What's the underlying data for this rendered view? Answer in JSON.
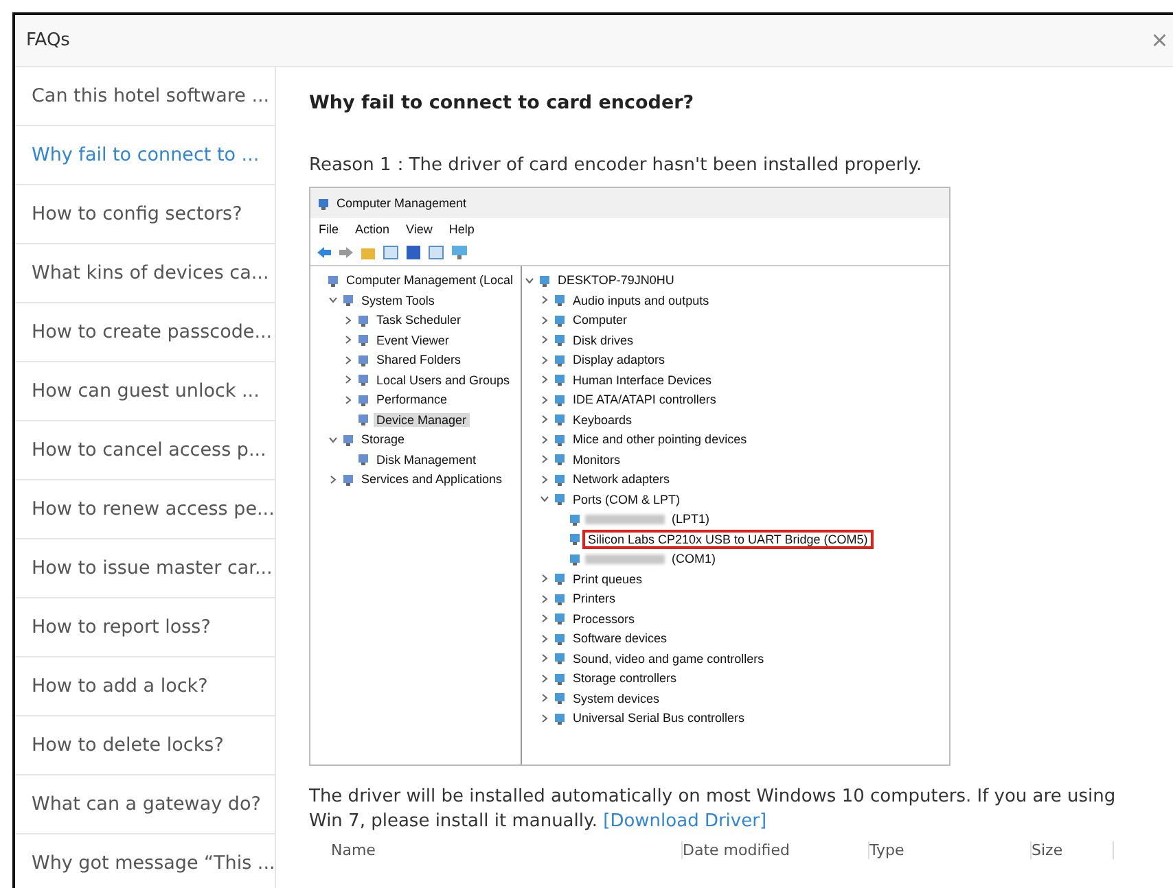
{
  "window": {
    "title": "FAQs",
    "close": "×"
  },
  "sidebar": {
    "items": [
      {
        "label": "Can this hotel software ...",
        "selected": false
      },
      {
        "label": "Why fail to connect to ...",
        "selected": true
      },
      {
        "label": "How to config sectors?",
        "selected": false
      },
      {
        "label": "What kins of devices ca...",
        "selected": false
      },
      {
        "label": "How to create passcode...",
        "selected": false
      },
      {
        "label": "How can guest unlock ...",
        "selected": false
      },
      {
        "label": "How to cancel access p...",
        "selected": false
      },
      {
        "label": "How to renew access pe...",
        "selected": false
      },
      {
        "label": "How to issue master car...",
        "selected": false
      },
      {
        "label": "How to report loss?",
        "selected": false
      },
      {
        "label": "How to add a lock?",
        "selected": false
      },
      {
        "label": "How to delete locks?",
        "selected": false
      },
      {
        "label": "What can a gateway do?",
        "selected": false
      },
      {
        "label": "Why got message “This ...",
        "selected": false
      }
    ]
  },
  "article": {
    "title": "Why fail to connect to card encoder?",
    "reason": "Reason 1：The driver of card encoder hasn't been installed properly.",
    "screenshot": {
      "title": "Computer Management",
      "menu": [
        "File",
        "Action",
        "View",
        "Help"
      ],
      "left_tree": [
        {
          "label": "Computer Management (Local",
          "selected": false,
          "children": [
            {
              "label": "System Tools",
              "expanded": true,
              "selected": false,
              "children": [
                {
                  "label": "Task Scheduler",
                  "expanded": false,
                  "selected": false
                },
                {
                  "label": "Event Viewer",
                  "expanded": false,
                  "selected": false
                },
                {
                  "label": "Shared Folders",
                  "expanded": false,
                  "selected": false
                },
                {
                  "label": "Local Users and Groups",
                  "expanded": false,
                  "selected": false
                },
                {
                  "label": "Performance",
                  "expanded": false,
                  "selected": false
                },
                {
                  "label": "Device Manager",
                  "selected": true
                }
              ]
            },
            {
              "label": "Storage",
              "expanded": true,
              "selected": false,
              "children": [
                {
                  "label": "Disk Management",
                  "selected": false
                }
              ]
            },
            {
              "label": "Services and Applications",
              "expanded": false,
              "selected": false
            }
          ]
        }
      ],
      "right_tree": [
        {
          "label": "DESKTOP-79JN0HU",
          "expanded": true,
          "children": [
            {
              "label": "Audio inputs and outputs",
              "expanded": false
            },
            {
              "label": "Computer",
              "expanded": false
            },
            {
              "label": "Disk drives",
              "expanded": false
            },
            {
              "label": "Display adaptors",
              "expanded": false
            },
            {
              "label": "Human Interface Devices",
              "expanded": false
            },
            {
              "label": "IDE ATA/ATAPI controllers",
              "expanded": false
            },
            {
              "label": "Keyboards",
              "expanded": false
            },
            {
              "label": "Mice and other pointing devices",
              "expanded": false
            },
            {
              "label": "Monitors",
              "expanded": false
            },
            {
              "label": "Network adapters",
              "expanded": false
            },
            {
              "label": "Ports (COM & LPT)",
              "expanded": true,
              "children": [
                {
                  "label": "(LPT1)",
                  "redacted": true,
                  "highlighted": false
                },
                {
                  "label": "Silicon Labs CP210x USB to UART Bridge (COM5)",
                  "redacted": false,
                  "highlighted": true
                },
                {
                  "label": "(COM1)",
                  "redacted": true,
                  "highlighted": false
                }
              ]
            },
            {
              "label": "Print queues",
              "expanded": false
            },
            {
              "label": "Printers",
              "expanded": false
            },
            {
              "label": "Processors",
              "expanded": false
            },
            {
              "label": "Software devices",
              "expanded": false
            },
            {
              "label": "Sound, video and game controllers",
              "expanded": false
            },
            {
              "label": "Storage controllers",
              "expanded": false
            },
            {
              "label": "System devices",
              "expanded": false
            },
            {
              "label": "Universal Serial Bus controllers",
              "expanded": false
            }
          ]
        }
      ]
    },
    "note": "The driver will be installed automatically on most Windows 10 computers. If you are using Win 7, please install it manually.",
    "link": "[Download Driver]",
    "file_columns": [
      "Name",
      "Date modified",
      "Type",
      "Size"
    ]
  }
}
